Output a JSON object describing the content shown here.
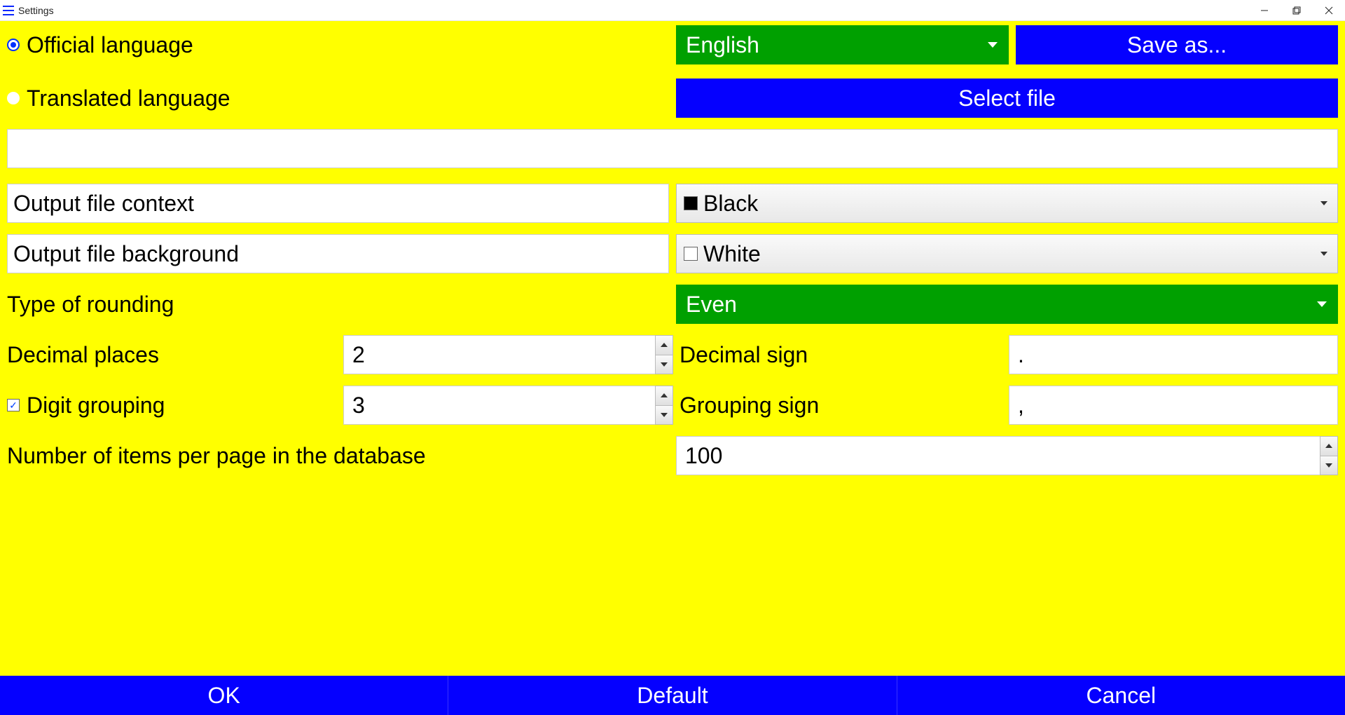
{
  "window": {
    "title": "Settings"
  },
  "lang": {
    "official_label": "Official language",
    "translated_label": "Translated language",
    "selected": "English",
    "saveas_label": "Save as...",
    "selectfile_label": "Select file"
  },
  "output": {
    "context_label": "Output file context",
    "context_value": "Black",
    "context_swatch": "#000000",
    "background_label": "Output file background",
    "background_value": "White",
    "background_swatch": "#ffffff"
  },
  "rounding": {
    "label": "Type of rounding",
    "value": "Even"
  },
  "decimal": {
    "places_label": "Decimal places",
    "places_value": "2",
    "sign_label": "Decimal sign",
    "sign_value": "."
  },
  "grouping": {
    "label": "Digit grouping",
    "value": "3",
    "sign_label": "Grouping sign",
    "sign_value": ","
  },
  "paging": {
    "label": "Number of items per page in the database",
    "value": "100"
  },
  "buttons": {
    "ok": "OK",
    "default": "Default",
    "cancel": "Cancel"
  }
}
